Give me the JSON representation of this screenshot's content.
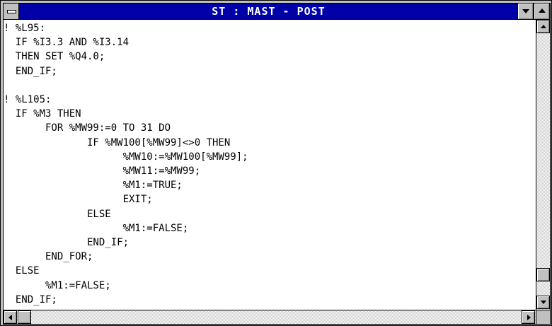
{
  "window": {
    "title": "ST : MAST - POST",
    "system_menu_icon": "system-menu-icon",
    "minimize_icon": "down-triangle-icon",
    "maximize_icon": "up-triangle-icon"
  },
  "editor": {
    "lines": [
      "! %L95:",
      "  IF %I3.3 AND %I3.14",
      "  THEN SET %Q4.0;",
      "  END_IF;",
      "",
      "! %L105:",
      "  IF %M3 THEN",
      "       FOR %MW99:=0 TO 31 DO",
      "              IF %MW100[%MW99]<>0 THEN",
      "                    %MW10:=%MW100[%MW99];",
      "                    %MW11:=%MW99;",
      "                    %M1:=TRUE;",
      "                    EXIT;",
      "              ELSE",
      "                    %M1:=FALSE;",
      "              END_IF;",
      "       END_FOR;",
      "  ELSE",
      "       %M1:=FALSE;",
      "  END_IF;"
    ]
  },
  "scrollbars": {
    "vertical": {
      "up_icon": "up-arrow-icon",
      "down_icon": "down-arrow-icon"
    },
    "horizontal": {
      "left_icon": "left-arrow-icon",
      "right_icon": "right-arrow-icon"
    }
  }
}
